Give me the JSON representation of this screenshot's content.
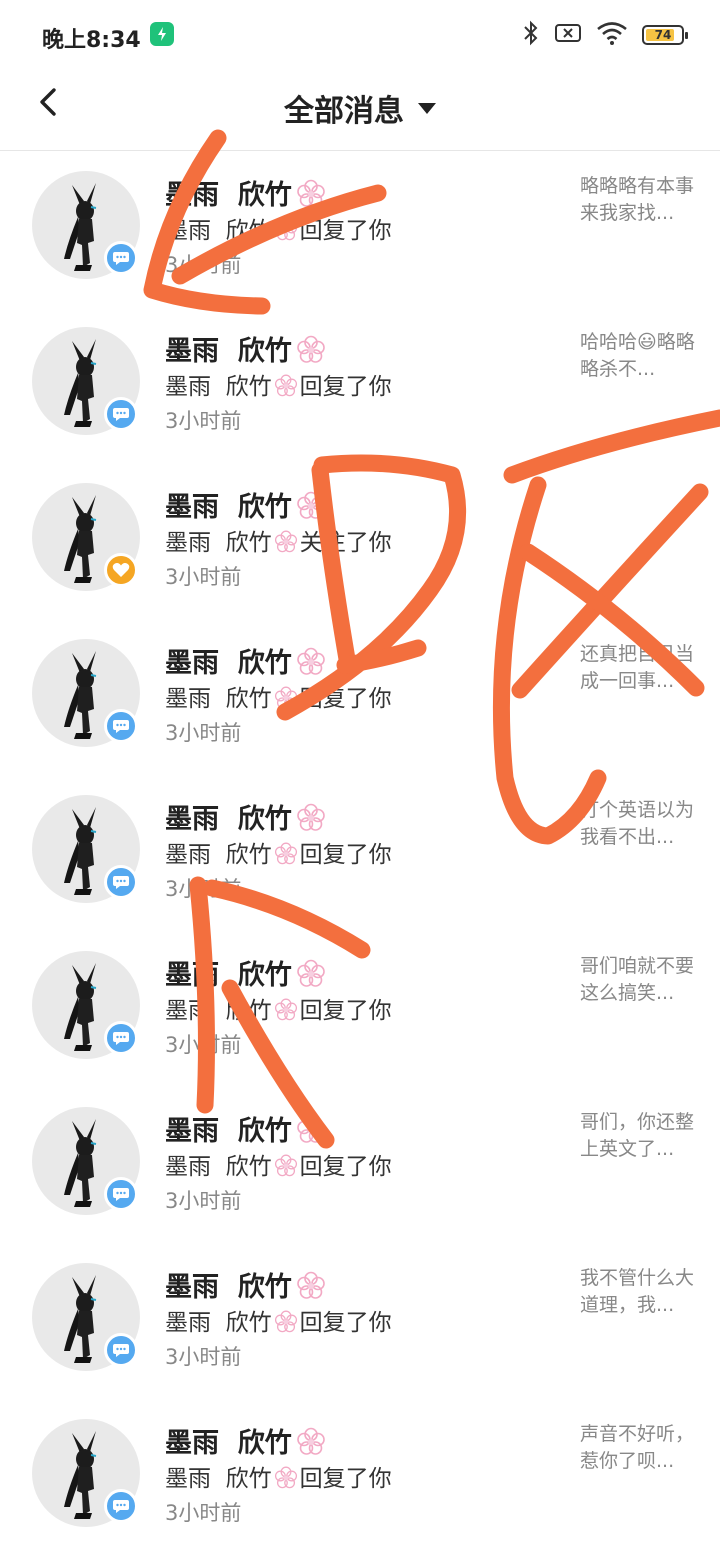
{
  "status_bar": {
    "time": "晚上8:34",
    "battery": "74",
    "icons": [
      "app-notification-icon",
      "bluetooth-icon",
      "sim-off-icon",
      "wifi-icon",
      "battery-icon"
    ]
  },
  "header": {
    "title": "全部消息",
    "back_icon": "chevron-left-icon",
    "dropdown_icon": "caret-down-icon"
  },
  "messages": [
    {
      "name": "墨雨  欣竹",
      "action": "回复了你",
      "time": "3小时前",
      "preview": "略略略有本事来我家找...",
      "badge": "chat"
    },
    {
      "name": "墨雨  欣竹",
      "action": "回复了你",
      "time": "3小时前",
      "preview": "哈哈哈😃略略略杀不...",
      "badge": "chat"
    },
    {
      "name": "墨雨  欣竹",
      "action": "关注了你",
      "time": "3小时前",
      "preview": "",
      "badge": "like"
    },
    {
      "name": "墨雨  欣竹",
      "action": "回复了你",
      "time": "3小时前",
      "preview": "还真把自己当成一回事...",
      "badge": "chat"
    },
    {
      "name": "墨雨  欣竹",
      "action": "回复了你",
      "time": "3小时前",
      "preview": "打个英语以为我看不出...",
      "badge": "chat"
    },
    {
      "name": "墨雨  欣竹",
      "action": "回复了你",
      "time": "3小时前",
      "preview": "哥们咱就不要这么搞笑...",
      "badge": "chat"
    },
    {
      "name": "墨雨  欣竹",
      "action": "回复了你",
      "time": "3小时前",
      "preview": "哥们，你还整上英文了...",
      "badge": "chat"
    },
    {
      "name": "墨雨  欣竹",
      "action": "回复了你",
      "time": "3小时前",
      "preview": "我不管什么大道理，我...",
      "badge": "chat"
    },
    {
      "name": "墨雨  欣竹",
      "action": "回复了你",
      "time": "3小时前",
      "preview": "声音不好听，惹你了呗...",
      "badge": "chat"
    }
  ],
  "colors": {
    "scribble": "#f36f3e",
    "badge_chat": "#55a9f0",
    "badge_like": "#f5a623",
    "flower": "#f2a9c4"
  }
}
